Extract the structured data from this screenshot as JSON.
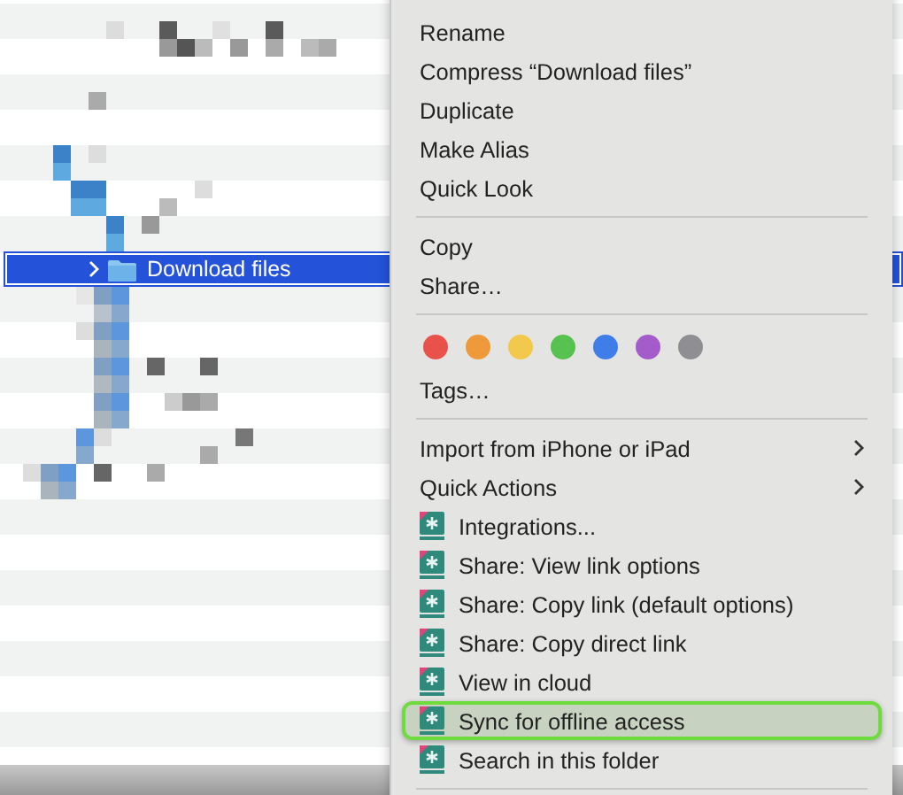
{
  "file_list": {
    "rows": [
      {
        "selected": false
      },
      {
        "selected": false
      },
      {
        "selected": false
      },
      {
        "selected": false
      },
      {
        "selected": false
      },
      {
        "selected": false
      },
      {
        "selected": false
      },
      {
        "selected": true,
        "label": "Download files"
      },
      {
        "selected": false
      },
      {
        "selected": false
      },
      {
        "selected": false
      },
      {
        "selected": false
      },
      {
        "selected": false
      },
      {
        "selected": false
      },
      {
        "selected": false
      },
      {
        "selected": false
      },
      {
        "selected": false
      },
      {
        "selected": false
      },
      {
        "selected": false
      },
      {
        "selected": false
      },
      {
        "selected": false
      }
    ]
  },
  "context_menu": {
    "items": [
      {
        "kind": "text",
        "label": "Rename",
        "highlighted": false
      },
      {
        "kind": "text",
        "label": "Compress “Download files”",
        "highlighted": false
      },
      {
        "kind": "text",
        "label": "Duplicate",
        "highlighted": false
      },
      {
        "kind": "text",
        "label": "Make Alias",
        "highlighted": false
      },
      {
        "kind": "text",
        "label": "Quick Look",
        "highlighted": false
      },
      {
        "kind": "separator"
      },
      {
        "kind": "text",
        "label": "Copy",
        "highlighted": false
      },
      {
        "kind": "text",
        "label": "Share…",
        "highlighted": false
      },
      {
        "kind": "separator"
      },
      {
        "kind": "tags",
        "colors": [
          {
            "color": "#e8524a"
          },
          {
            "color": "#ee9a3a"
          },
          {
            "color": "#f2c94c"
          },
          {
            "color": "#57c24f"
          },
          {
            "color": "#3f7de8"
          },
          {
            "color": "#a35cc9"
          },
          {
            "color": "#8e8e93"
          }
        ]
      },
      {
        "kind": "text",
        "label": "Tags…",
        "highlighted": false
      },
      {
        "kind": "separator"
      },
      {
        "kind": "submenu",
        "label": "Import from iPhone or iPad",
        "highlighted": false
      },
      {
        "kind": "submenu",
        "label": "Quick Actions",
        "highlighted": false
      },
      {
        "kind": "app",
        "label": "Integrations...",
        "highlighted": false
      },
      {
        "kind": "app",
        "label": "Share: View link options",
        "highlighted": false
      },
      {
        "kind": "app",
        "label": "Share: Copy link (default options)",
        "highlighted": false
      },
      {
        "kind": "app",
        "label": "Share: Copy direct link",
        "highlighted": false
      },
      {
        "kind": "app",
        "label": "View in cloud",
        "highlighted": false
      },
      {
        "kind": "app",
        "label": "Sync for offline access",
        "highlighted": true
      },
      {
        "kind": "app",
        "label": "Search in this folder",
        "highlighted": false
      },
      {
        "kind": "separator"
      }
    ]
  }
}
